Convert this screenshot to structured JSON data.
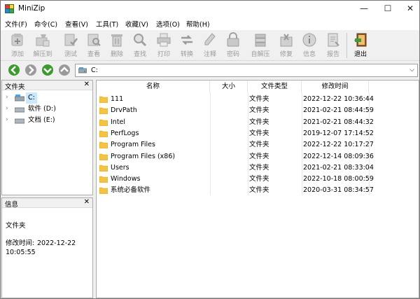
{
  "window": {
    "title": "MiniZip",
    "controls": {
      "minimize": "—",
      "maximize": "☐",
      "close": "✕"
    }
  },
  "menubar": {
    "items": [
      "文件(F)",
      "命令(C)",
      "查看(V)",
      "工具(T)",
      "收藏(V)",
      "选项(O)",
      "帮助(H)"
    ]
  },
  "toolbar": {
    "buttons": [
      {
        "label": "添加",
        "icon": "add-icon"
      },
      {
        "label": "解压到",
        "icon": "extract-to-icon"
      },
      {
        "label": "测试",
        "icon": "test-icon"
      },
      {
        "label": "查看",
        "icon": "view-icon"
      },
      {
        "label": "删除",
        "icon": "delete-icon"
      },
      {
        "label": "查找",
        "icon": "find-icon"
      },
      {
        "label": "打印",
        "icon": "print-icon"
      },
      {
        "label": "转换",
        "icon": "convert-icon"
      },
      {
        "label": "注释",
        "icon": "comment-icon"
      },
      {
        "label": "密码",
        "icon": "password-icon"
      },
      {
        "label": "自解压",
        "icon": "sfx-icon"
      },
      {
        "label": "修复",
        "icon": "repair-icon"
      },
      {
        "label": "信息",
        "icon": "info-icon"
      },
      {
        "label": "报告",
        "icon": "report-icon"
      },
      {
        "label": "退出",
        "icon": "exit-icon"
      }
    ]
  },
  "navbar": {
    "address": "C:"
  },
  "folders_pane": {
    "title": "文件夹",
    "close": "✕",
    "items": [
      {
        "label": "C:",
        "selected": true
      },
      {
        "label": "软件 (D:)",
        "selected": false
      },
      {
        "label": "文档 (E:)",
        "selected": false
      }
    ]
  },
  "info_pane": {
    "title": "信息",
    "close": "✕",
    "type_text": "文件夹",
    "modified_label": "修改时间:",
    "modified_date": "2022-12-22",
    "modified_time": "10:05:55"
  },
  "file_list": {
    "columns": {
      "name": "名称",
      "size": "大小",
      "type": "文件类型",
      "modified": "修改时间"
    },
    "rows": [
      {
        "name": "111",
        "size": "",
        "type": "文件夹",
        "modified": "2022-12-22 10:36:44"
      },
      {
        "name": "DrvPath",
        "size": "",
        "type": "文件夹",
        "modified": "2021-02-21 08:44:59"
      },
      {
        "name": "Intel",
        "size": "",
        "type": "文件夹",
        "modified": "2021-02-21 08:44:32"
      },
      {
        "name": "PerfLogs",
        "size": "",
        "type": "文件夹",
        "modified": "2019-12-07 17:14:52"
      },
      {
        "name": "Program Files",
        "size": "",
        "type": "文件夹",
        "modified": "2022-12-22 10:17:27"
      },
      {
        "name": "Program Files (x86)",
        "size": "",
        "type": "文件夹",
        "modified": "2022-12-14 08:09:36"
      },
      {
        "name": "Users",
        "size": "",
        "type": "文件夹",
        "modified": "2021-02-21 08:33:04"
      },
      {
        "name": "Windows",
        "size": "",
        "type": "文件夹",
        "modified": "2022-10-18 08:00:59"
      },
      {
        "name": "系统必备软件",
        "size": "",
        "type": "文件夹",
        "modified": "2020-03-31 08:34:57"
      }
    ]
  },
  "colors": {
    "folder": "#f5c342",
    "selection": "#cce8ff",
    "nav_green": "#3c9a2e",
    "nav_gray": "#9a9a9a"
  }
}
